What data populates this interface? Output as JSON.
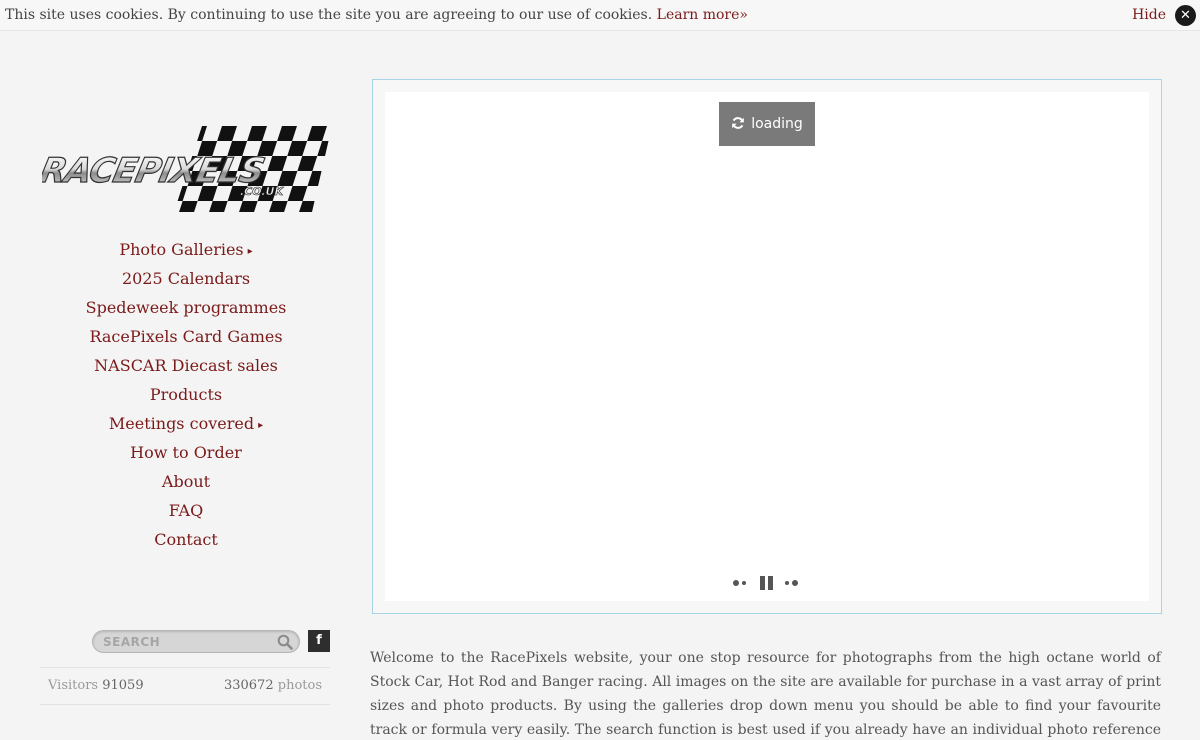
{
  "cookie_bar": {
    "message": "This site uses cookies. By continuing to use the site you are agreeing to our use of cookies.",
    "learn_more": "Learn more»",
    "hide": "Hide",
    "close_glyph": "✕"
  },
  "logo": {
    "text": "RACEPIXELS",
    "domain": ".CO.UK"
  },
  "nav": {
    "items": [
      {
        "label": "Photo Galleries",
        "submenu": "▸"
      },
      {
        "label": "2025 Calendars"
      },
      {
        "label": "Spedeweek programmes"
      },
      {
        "label": "RacePixels Card Games"
      },
      {
        "label": "NASCAR Diecast sales"
      },
      {
        "label": "Products"
      },
      {
        "label": "Meetings covered",
        "submenu": "▸"
      },
      {
        "label": "How to Order"
      },
      {
        "label": "About"
      },
      {
        "label": "FAQ"
      },
      {
        "label": "Contact"
      }
    ]
  },
  "search": {
    "placeholder": "SEARCH",
    "icon": "search-icon"
  },
  "social": {
    "facebook_glyph": "f"
  },
  "stats": {
    "visitors_label": "Visitors",
    "visitors_count": "91059",
    "photos_count": "330672",
    "photos_label": "photos"
  },
  "slideshow": {
    "loading_label": "loading",
    "icons": [
      "refresh-icon",
      "previous-icon",
      "pause-icon",
      "next-icon"
    ]
  },
  "intro": {
    "text": "Welcome to the RacePixels website, your one stop resource for photographs from the high octane world of Stock Car, Hot Rod and Banger racing. All images on the site are available for purchase in a vast array of print sizes and photo products. By using the galleries drop down menu you should be able to find your favourite track or formula very easily. The search function is best used if you already have an individual photo reference (often printed on the reverse"
  },
  "colors": {
    "link": "#7a1a1a",
    "text": "#555555",
    "background": "#f4f4f4",
    "slideshow_border": "#a6d5e6",
    "loading_bg": "#7a7a7a"
  }
}
